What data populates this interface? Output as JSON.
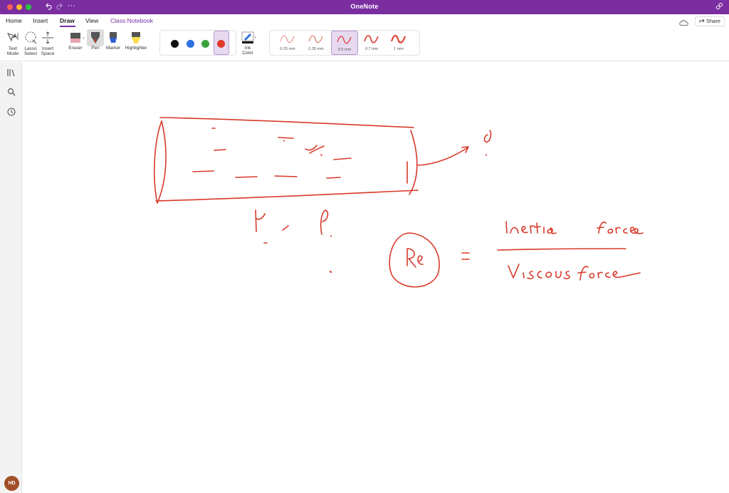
{
  "window": {
    "title": "OneNote"
  },
  "tabs": [
    {
      "label": "Home"
    },
    {
      "label": "Insert"
    },
    {
      "label": "Draw"
    },
    {
      "label": "View"
    },
    {
      "label": "Class Notebook"
    }
  ],
  "share": {
    "label": "Share"
  },
  "ribbon": {
    "text_mode": [
      "Text",
      "Mode"
    ],
    "lasso_select": [
      "Lasso",
      "Select"
    ],
    "insert_space": [
      "Insert",
      "Space"
    ],
    "eraser": "Eraser",
    "pen": "Pen",
    "marker": "Marker",
    "highlighter": "Highlighter",
    "ink_color": [
      "Ink",
      "Color"
    ],
    "colors": [
      "#111111",
      "#2f6fe0",
      "#3aa13a",
      "#e23b2a"
    ],
    "selected_color": "#e23b2a",
    "thickness": [
      "0.25 mm",
      "0.35 mm",
      "0.5 mm",
      "0.7 mm",
      "1 mm"
    ],
    "selected_thickness": "0.5 mm"
  },
  "user": {
    "initials": "HD"
  },
  "accent_color": "#7a2ea0",
  "ink_color": "#d8392b"
}
